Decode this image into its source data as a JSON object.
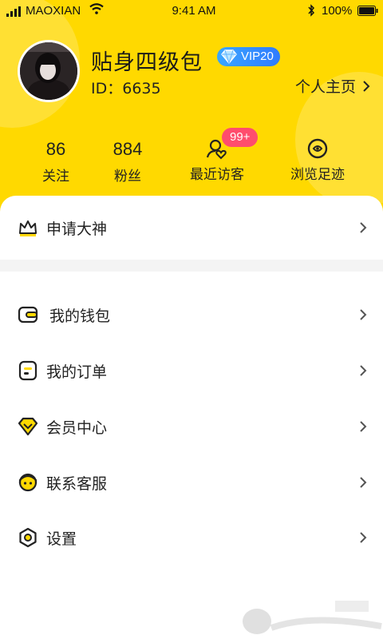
{
  "status_bar": {
    "carrier": "MAOXIAN",
    "time": "9:41 AM",
    "battery": "100%"
  },
  "profile": {
    "username": "贴身四级包",
    "vip": "VIP20",
    "id_label": "ID：6635",
    "home_link": "个人主页"
  },
  "stats": [
    {
      "value": "86",
      "label": "关注"
    },
    {
      "value": "884",
      "label": "粉丝"
    },
    {
      "label": "最近访客",
      "badge": "99+"
    },
    {
      "label": "浏览足迹"
    }
  ],
  "menu": {
    "apply": "申请大神",
    "wallet": "我的钱包",
    "orders": "我的订单",
    "vip_center": "会员中心",
    "service": "联系客服",
    "settings": "设置"
  },
  "colors": {
    "brand": "#FFD900",
    "badge": "#FF4D6D",
    "vip": "#3aa6ff"
  }
}
